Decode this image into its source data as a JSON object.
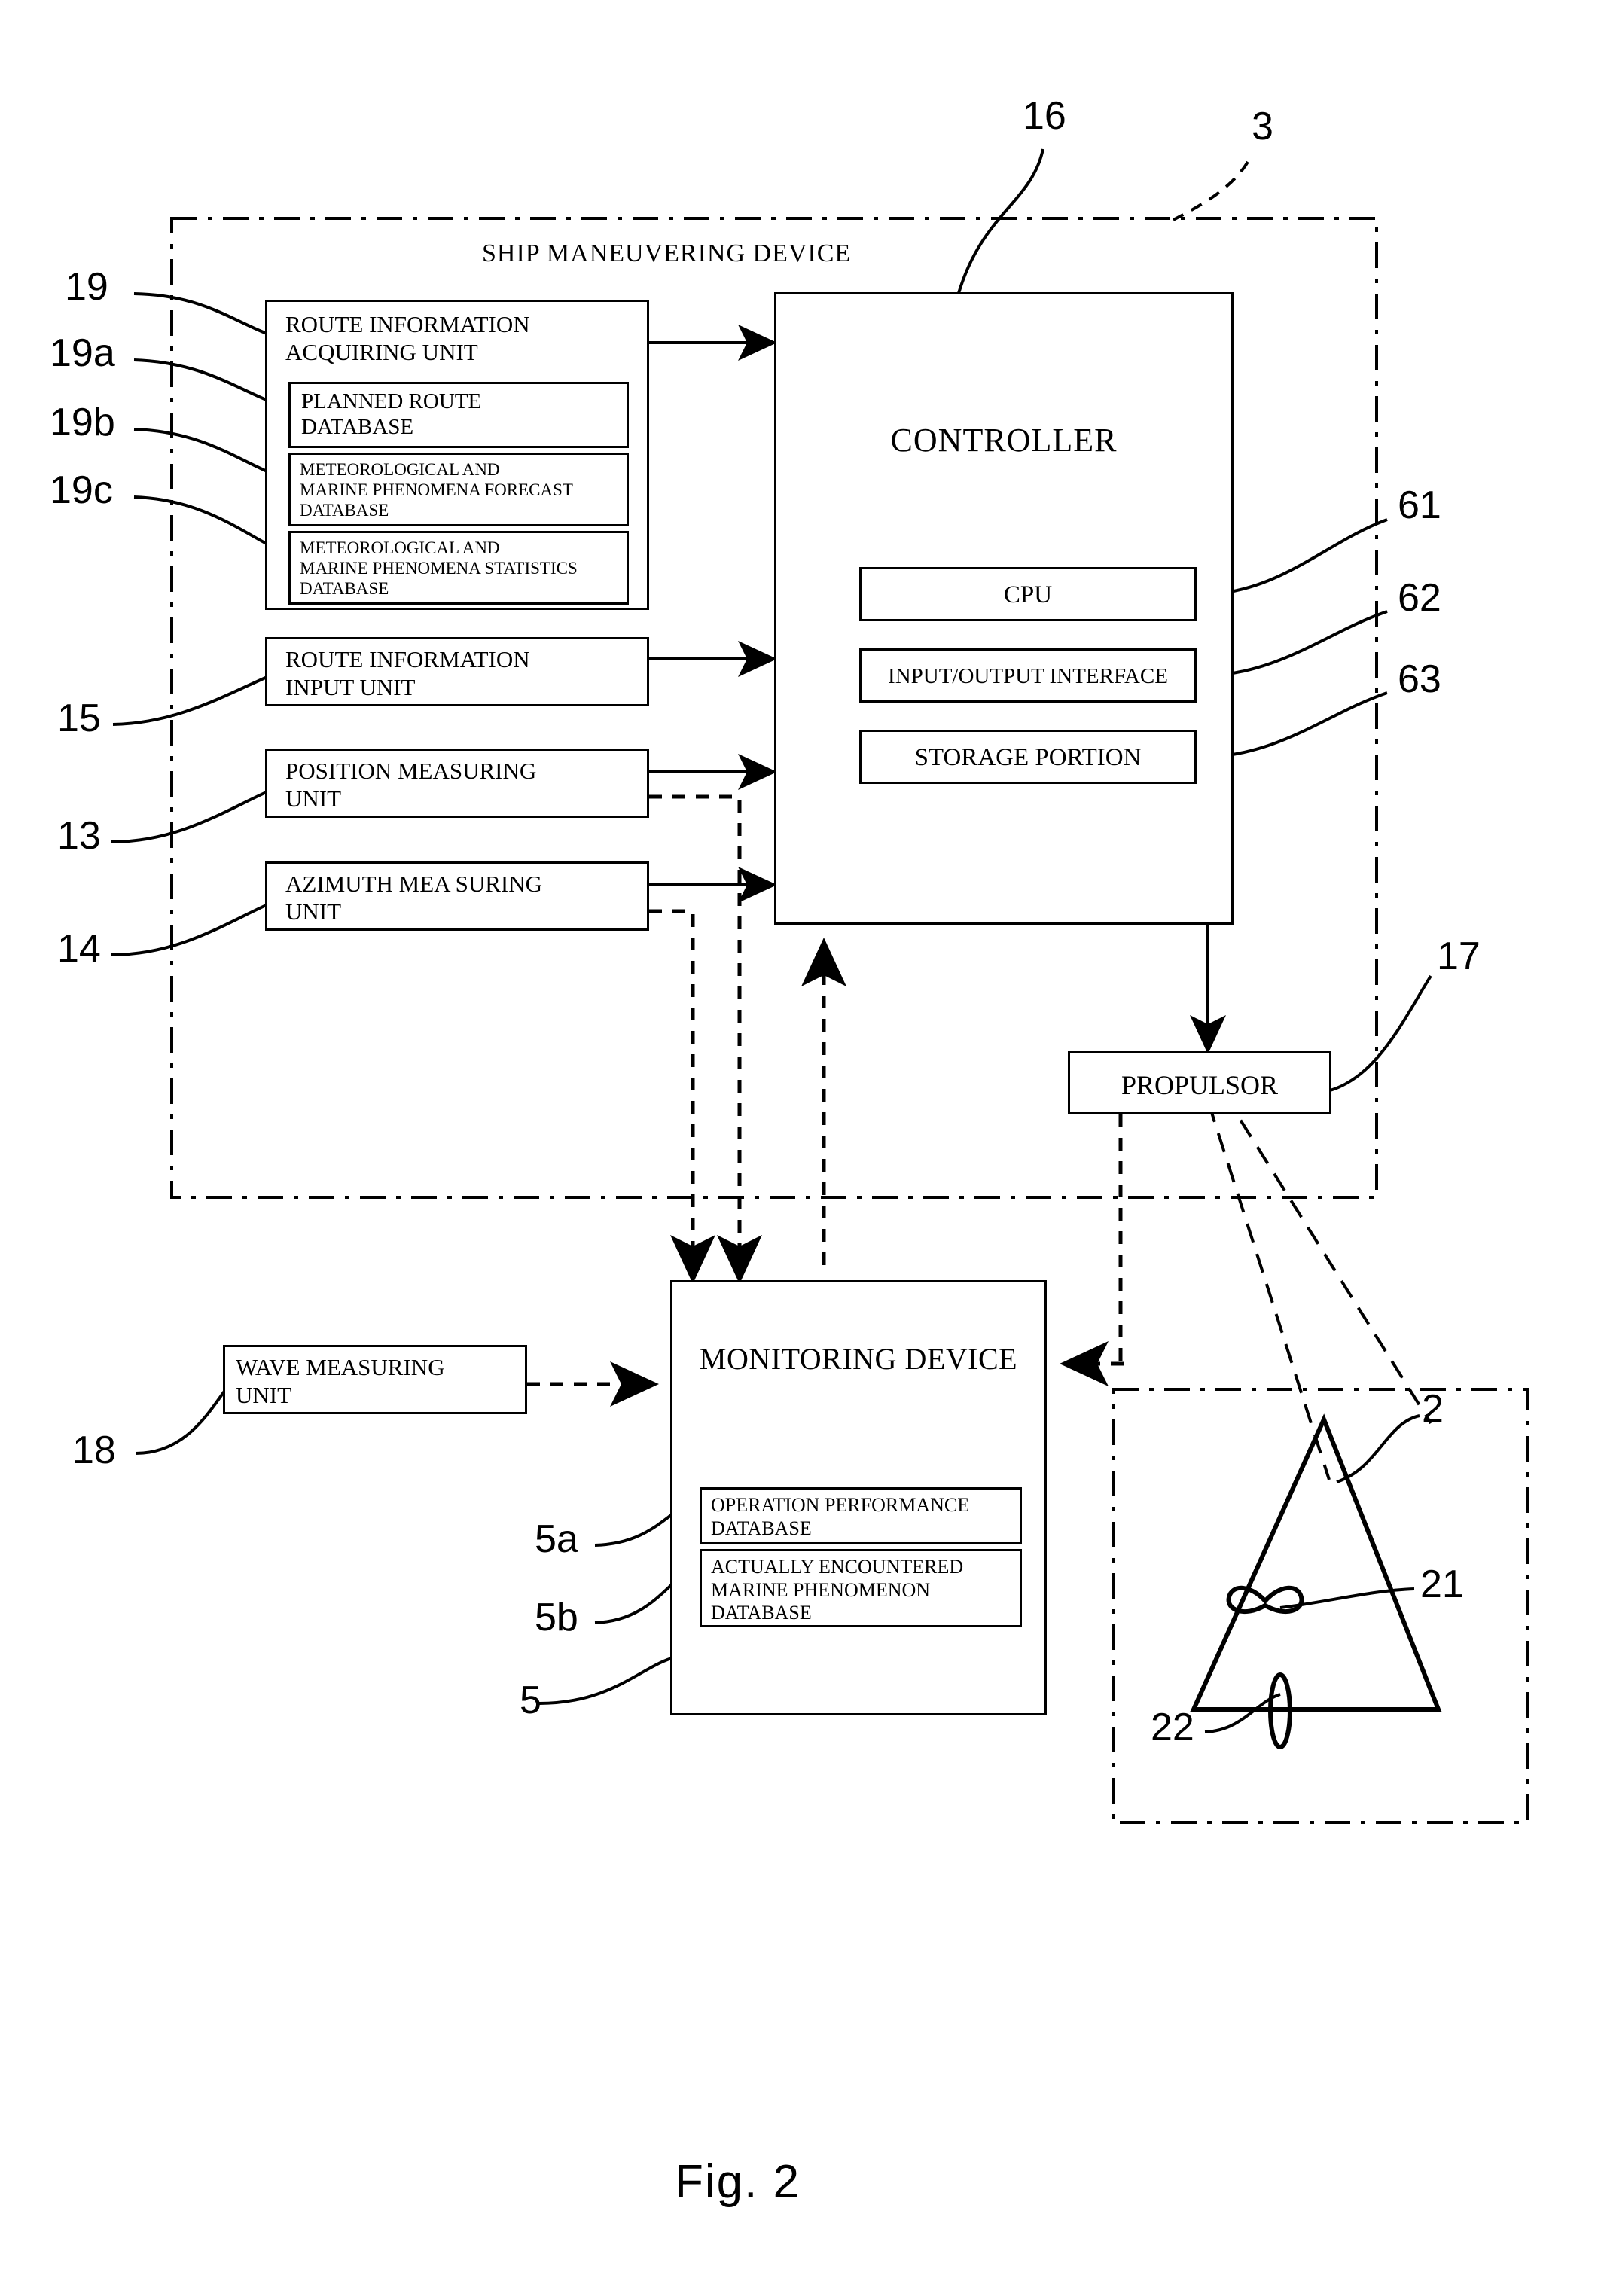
{
  "figure": {
    "caption": "Fig. 2",
    "outer_enclosure_label": "SHIP MANEUVERING DEVICE"
  },
  "boxes": {
    "route_info_acquiring_unit": {
      "label": "ROUTE INFORMATION\nACQUIRING UNIT",
      "ref": "19"
    },
    "planned_route_db": {
      "label": "PLANNED ROUTE\nDATABASE",
      "ref": "19a"
    },
    "met_marine_forecast_db": {
      "label": "METEOROLOGICAL AND\nMARINE PHENOMENA FORECAST\nDATABASE",
      "ref": "19b"
    },
    "met_marine_statistics_db": {
      "label": "METEOROLOGICAL AND\nMARINE PHENOMENA STATISTICS\nDATABASE",
      "ref": "19c"
    },
    "route_info_input_unit": {
      "label": "ROUTE INFORMATION\nINPUT UNIT",
      "ref": "15"
    },
    "position_measuring_unit": {
      "label": "POSITION  MEASURING\nUNIT",
      "ref": "13"
    },
    "azimuth_measuring_unit": {
      "label": "AZIMUTH MEA SURING\nUNIT",
      "ref": "14"
    },
    "controller": {
      "label": "CONTROLLER",
      "ref": "16"
    },
    "cpu": {
      "label": "CPU",
      "ref": "61"
    },
    "io_interface": {
      "label": "INPUT/OUTPUT INTERFACE",
      "ref": "62"
    },
    "storage_portion": {
      "label": "STORAGE PORTION",
      "ref": "63"
    },
    "propulsor": {
      "label": "PROPULSOR",
      "ref": "17"
    },
    "monitoring_device": {
      "label": "MONITORING DEVICE",
      "ref": "5"
    },
    "operation_performance_db": {
      "label": "OPERATION PERFORMANCE\nDATABASE",
      "ref": "5a"
    },
    "actually_encountered_db": {
      "label": "ACTUALLY ENCOUNTERED\nMARINE PHENOMENON\nDATABASE",
      "ref": "5b"
    },
    "wave_measuring_unit": {
      "label": "WAVE MEASURING\nUNIT",
      "ref": "18"
    }
  },
  "ship": {
    "hull_ref": "2",
    "propeller_ref": "21",
    "rudder_ref": "22"
  },
  "refs": {
    "ship_maneuvering_device": "3",
    "r19": "19",
    "r19a": "19a",
    "r19b": "19b",
    "r19c": "19c",
    "r15": "15",
    "r13": "13",
    "r14": "14",
    "r16": "16",
    "r61": "61",
    "r62": "62",
    "r63": "63",
    "r17": "17",
    "r18": "18",
    "r5": "5",
    "r5a": "5a",
    "r5b": "5b",
    "r2": "2",
    "r21": "21",
    "r22": "22"
  },
  "colors": {
    "line": "#000000",
    "background": "#ffffff"
  }
}
